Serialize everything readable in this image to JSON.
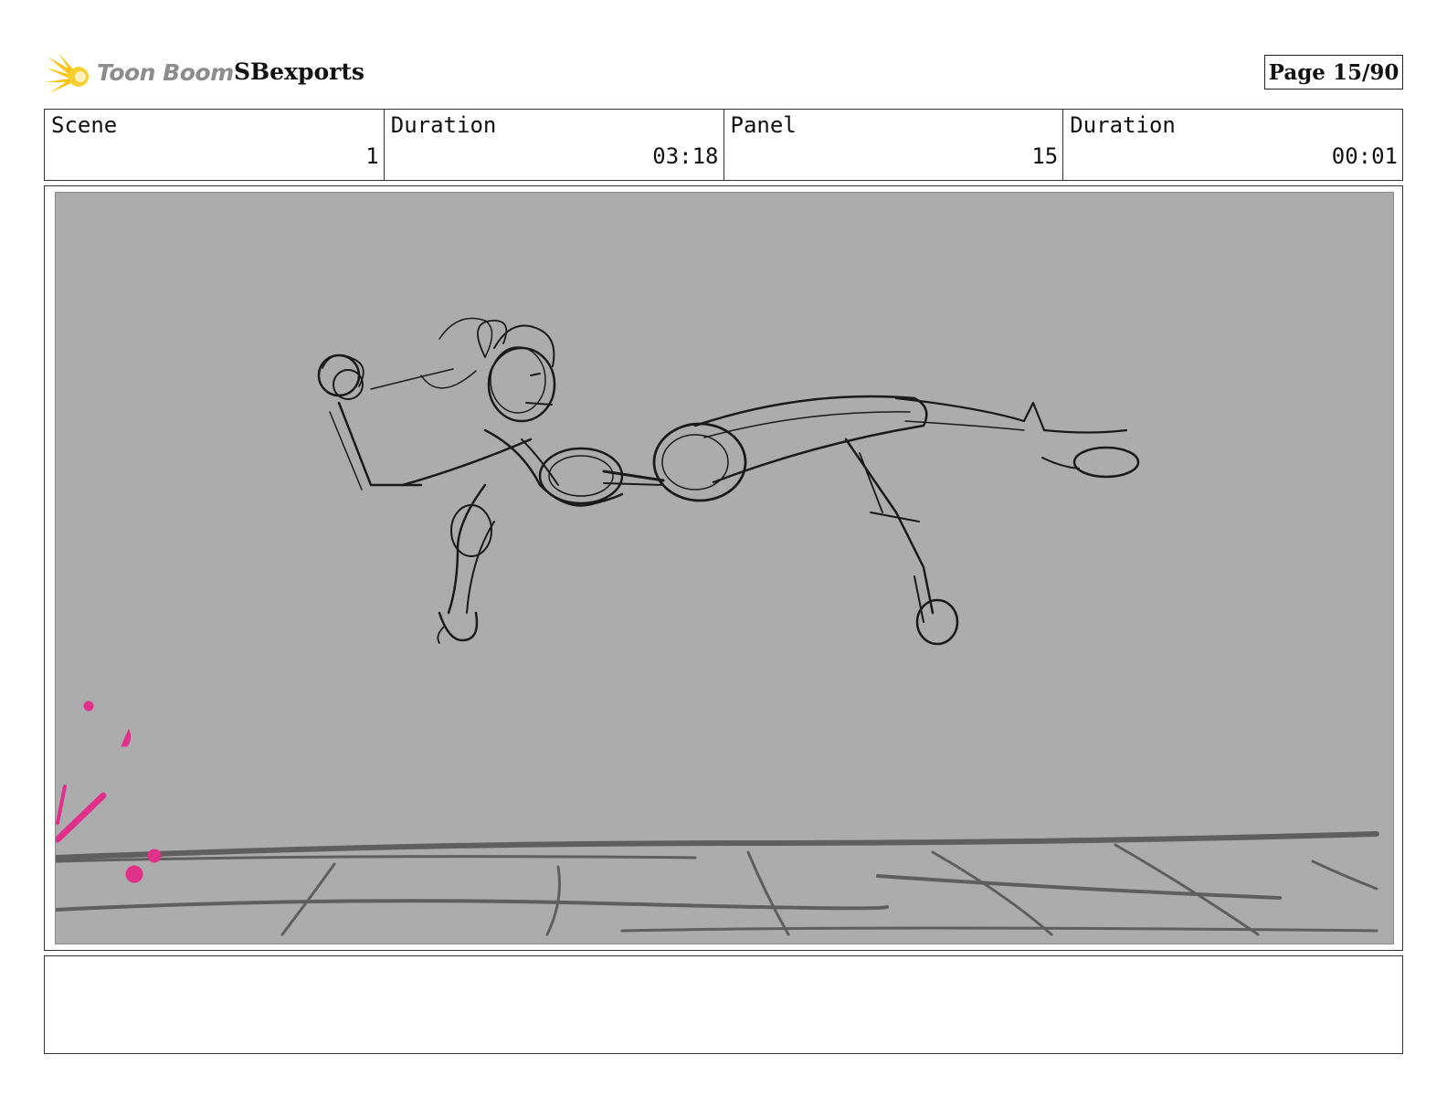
{
  "header": {
    "logo_text": "Toon Boom",
    "project": "SBexports",
    "page_label": "Page 15/90"
  },
  "info": {
    "scene_label": "Scene",
    "scene_value": "1",
    "scene_duration_label": "Duration",
    "scene_duration_value": "03:18",
    "panel_label": "Panel",
    "panel_value": "15",
    "panel_duration_label": "Duration",
    "panel_duration_value": "00:01"
  },
  "colors": {
    "frame_background": "#acacac",
    "sketch_lines": "#1a1a1a",
    "floor_lines": "#5f5f5f",
    "effect_accent": "#e0308a",
    "logo_star": "#f5c518"
  },
  "notes": {
    "text": ""
  }
}
